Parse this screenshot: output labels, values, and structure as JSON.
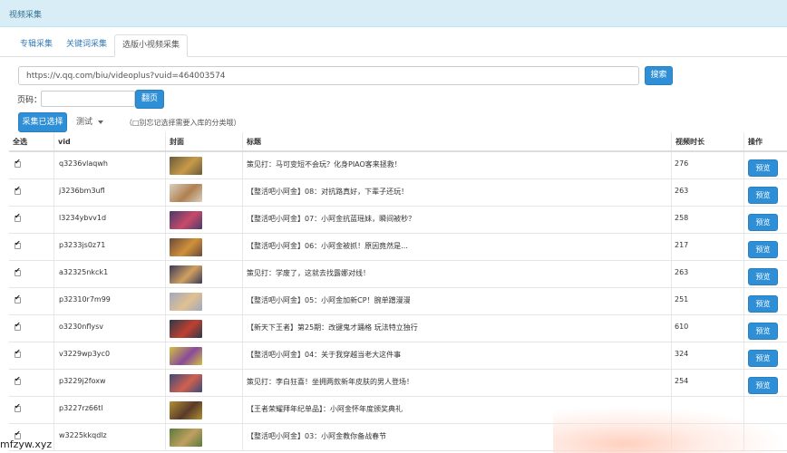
{
  "window": {
    "title": "视频采集"
  },
  "tabs": [
    {
      "label": "专辑采集",
      "active": false
    },
    {
      "label": "关键词采集",
      "active": false
    },
    {
      "label": "选版小视频采集",
      "active": true
    }
  ],
  "search": {
    "url_value": "https://v.qq.com/biu/videoplus?vuid=464003574",
    "button": "搜索"
  },
  "pager": {
    "label": "页码：",
    "value": "",
    "button": "翻页"
  },
  "actions": {
    "collect_label": "采集已选择",
    "category_select": "测试",
    "hint": "（□别忘记选择需要入库的分类哦）"
  },
  "table": {
    "headers": [
      "全选",
      "vid",
      "封面",
      "标题",
      "视频时长",
      "操作"
    ],
    "preview_label": "预览",
    "rows": [
      {
        "vid": "q3236vlaqwh",
        "title": "策见打：马可变短不会玩？化身PIAO客来拯救！",
        "duration": "276",
        "thumb_colors": [
          "#6b5a3a",
          "#c79a4a"
        ]
      },
      {
        "vid": "j3236bm3ufl",
        "title": "【整活吧小阿金】08：对抗路真好，下辈子还玩！",
        "duration": "263",
        "thumb_colors": [
          "#d8d0c0",
          "#b08050"
        ]
      },
      {
        "vid": "l3234ybvv1d",
        "title": "【整活吧小阿金】07：小阿金抗蓝瑶妹，瞬间被秒？",
        "duration": "258",
        "thumb_colors": [
          "#4a3a6a",
          "#c84a6a"
        ]
      },
      {
        "vid": "p3233js0z71",
        "title": "【整活吧小阿金】06：小阿金被抓！原因竟然是...",
        "duration": "217",
        "thumb_colors": [
          "#6a4a3a",
          "#d0903a"
        ]
      },
      {
        "vid": "a32325nkck1",
        "title": "策见打：学废了，这就去找露娜对线！",
        "duration": "263",
        "thumb_colors": [
          "#3a3a5a",
          "#d0a060"
        ]
      },
      {
        "vid": "p32310r7m99",
        "title": "【整活吧小阿金】05：小阿金加新CP！腕单蹭漫漫",
        "duration": "251",
        "thumb_colors": [
          "#a0a8c0",
          "#e0c090"
        ]
      },
      {
        "vid": "o3230nflysv",
        "title": "【新天下王者】第25期：改键鬼才踊格 玩法特立独行",
        "duration": "610",
        "thumb_colors": [
          "#2a3a4a",
          "#c04030"
        ]
      },
      {
        "vid": "v3229wp3yc0",
        "title": "【整活吧小阿金】04：关于我穿越当老大这件事",
        "duration": "324",
        "thumb_colors": [
          "#d0c040",
          "#8a4a9a"
        ]
      },
      {
        "vid": "p3229j2foxw",
        "title": "策见打：李白狂喜！坐拥两款新年皮肤的男人登场！",
        "duration": "254",
        "thumb_colors": [
          "#3a4a7a",
          "#d06050"
        ]
      },
      {
        "vid": "p3227rz66tl",
        "title": "【王者荣耀拜年纪单品】：小阿金怀年度颁奖典礼",
        "duration": "",
        "thumb_colors": [
          "#b09030",
          "#5a3a2a"
        ]
      },
      {
        "vid": "w3225kkqdlz",
        "title": "【整活吧小阿金】03：小阿金教你备战春节",
        "duration": "",
        "thumb_colors": [
          "#5a7a3a",
          "#c0a060"
        ]
      }
    ]
  },
  "watermark": "mfzyw.xyz"
}
